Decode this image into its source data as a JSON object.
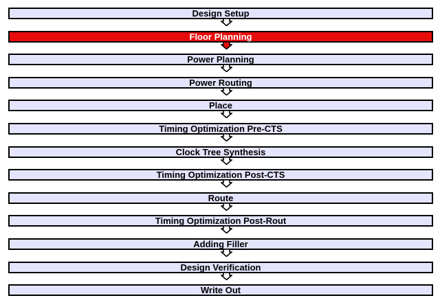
{
  "flow": {
    "steps": [
      "Design Setup",
      "Floor Planning",
      "Power Planning",
      "Power Routing",
      "Place",
      "Timing Optimization Pre-CTS",
      "Clock Tree Synthesis",
      "Timing Optimization Post-CTS",
      "Route",
      "Timing Optimization Post-Rout",
      "Adding Filler",
      "Design Verification",
      "Write Out"
    ],
    "active_step": "Floor Planning"
  },
  "colors": {
    "step_fill": "#e4e4fc",
    "active_fill": "#e80c0c",
    "active_text": "#ffffff",
    "border": "#000000",
    "arrow_fill": "#ffffff",
    "active_arrow_fill": "#e80c0c"
  },
  "icons": {
    "connector": "down-arrow-icon"
  }
}
